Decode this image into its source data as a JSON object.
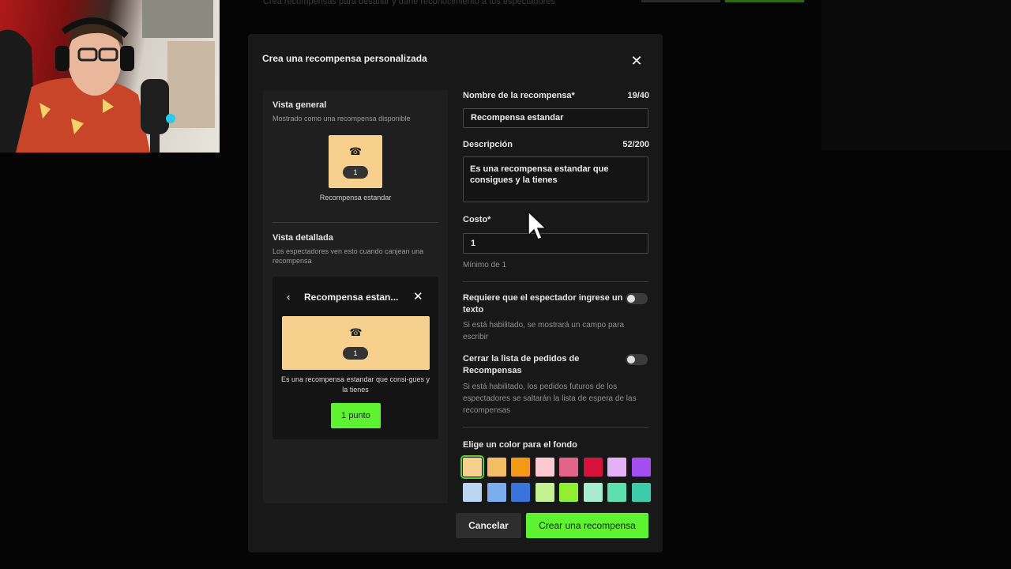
{
  "background": {
    "subtitle": "Crea recompensas para desafiar y darle reconocimiento a tus espectadores"
  },
  "modal": {
    "title": "Crea una recompensa personalizada"
  },
  "preview": {
    "overview_heading": "Vista general",
    "overview_sub": "Mostrado como una recompensa disponible",
    "tile_cost": "1",
    "tile_label": "Recompensa estandar",
    "detail_heading": "Vista detallada",
    "detail_sub": "Los espectadores ven esto cuando canjean una recompensa",
    "detail_title": "Recompensa estan...",
    "detail_cost": "1",
    "detail_desc": "Es una recompensa estandar que consi-gues y la tienes",
    "detail_button": "1 punto"
  },
  "form": {
    "name_label": "Nombre de la recompensa*",
    "name_count": "19/40",
    "name_value": "Recompensa estandar",
    "desc_label": "Descripción",
    "desc_count": "52/200",
    "desc_value": "Es una recompensa estandar que consigues y la tienes",
    "cost_label": "Costo*",
    "cost_value": "1",
    "cost_hint": "Mínimo de 1",
    "toggle1_label": "Requiere que el espectador ingrese un texto",
    "toggle1_hint": "Si está habilitado, se mostrará un campo para escribir",
    "toggle1_on": false,
    "toggle2_label": "Cerrar la lista de pedidos de Recompensas",
    "toggle2_hint": "Si está habilitado, los pedidos futuros de los espectadores se saltarán la lista de espera de las recompensas",
    "toggle2_on": false,
    "color_label": "Elige un color para el fondo",
    "colors_row1": [
      "#f6d08c",
      "#f2bd63",
      "#f39a14",
      "#f9c8d0",
      "#e2648a",
      "#d5133a",
      "#e4b1f9",
      "#a44ef0"
    ],
    "colors_row2": [
      "#bcd5f5",
      "#7aaeef",
      "#3a73dc",
      "#c3f28f",
      "#8ef030",
      "#a5ecd2",
      "#5be0b0",
      "#3dccaa"
    ],
    "selected_color": "#f6d08c"
  },
  "actions": {
    "cancel": "Cancelar",
    "create": "Crear una recompensa"
  }
}
